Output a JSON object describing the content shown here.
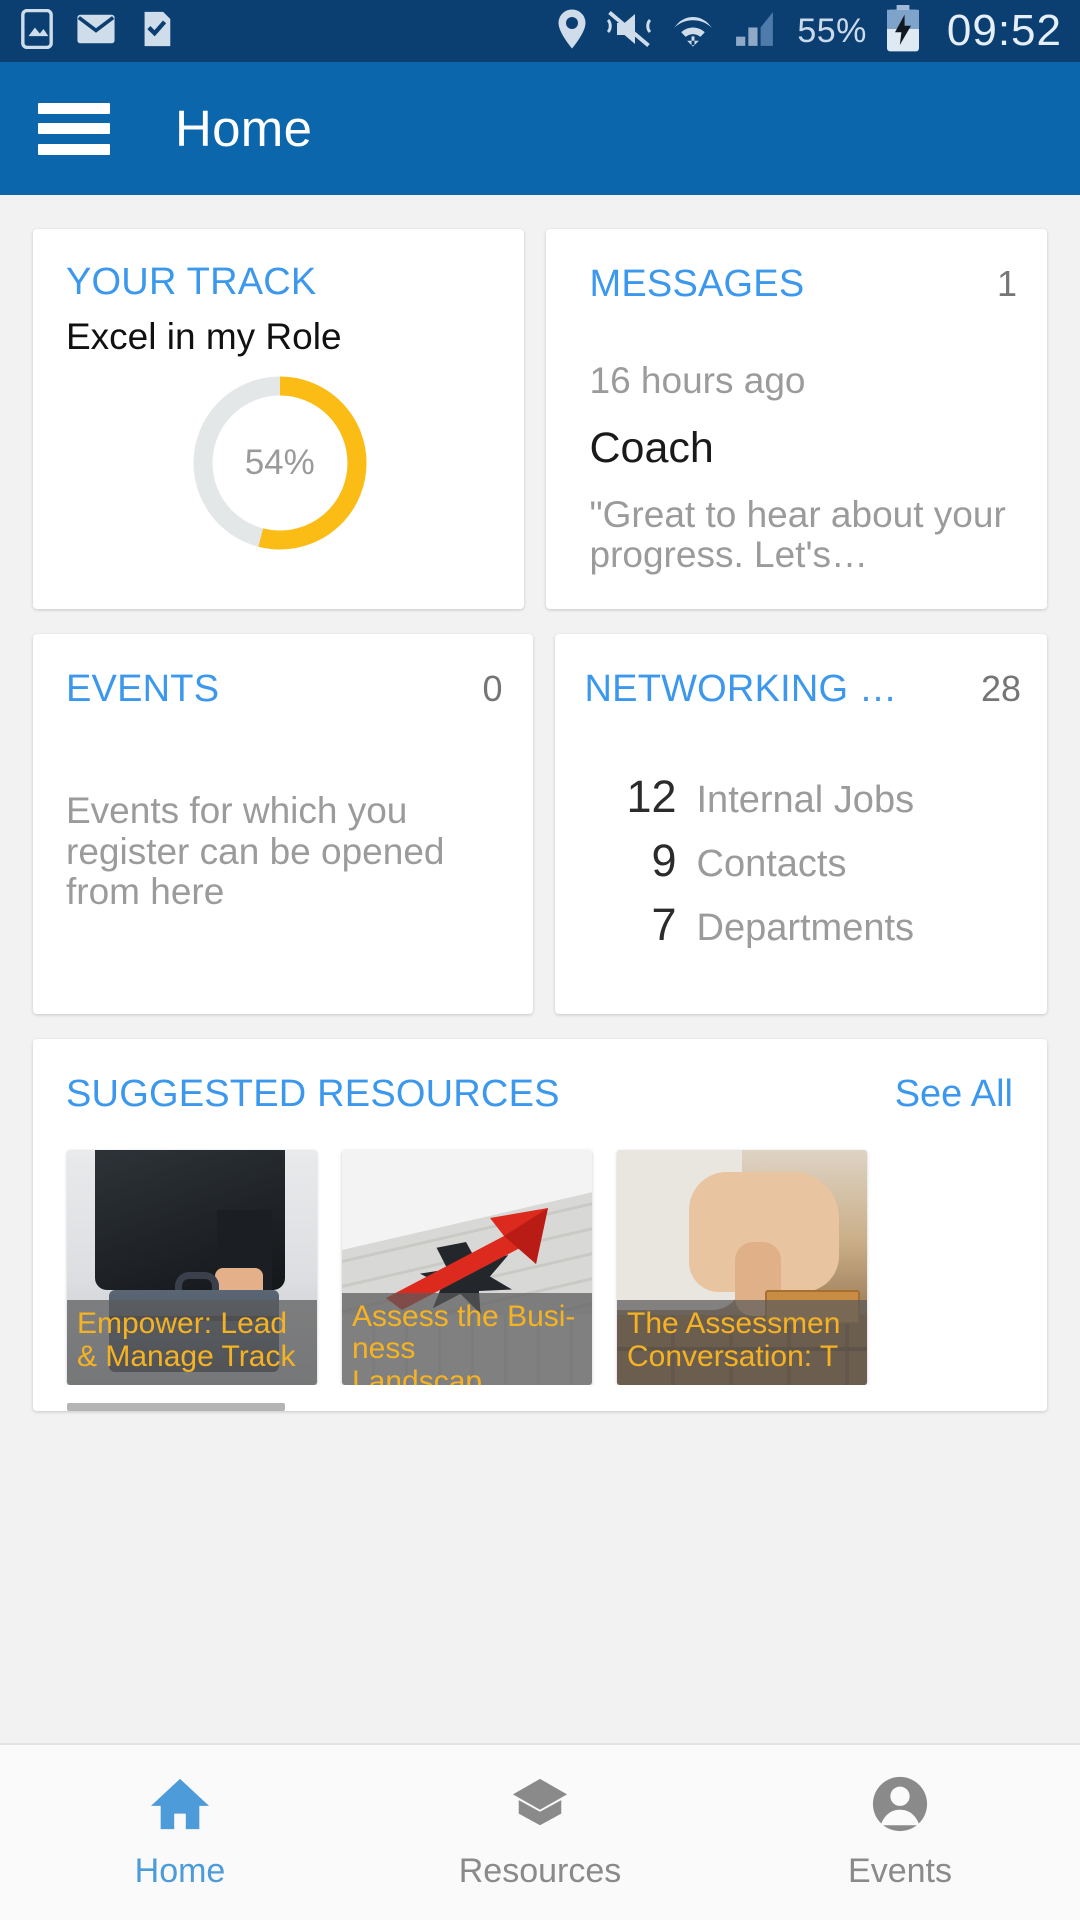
{
  "status_bar": {
    "icons_left": [
      "image-icon",
      "email-icon",
      "task-check-icon"
    ],
    "icons_right": [
      "location-pin-icon",
      "mute-vibrate-icon",
      "wifi-icon",
      "cellular-signal-icon"
    ],
    "battery_percent": "55%",
    "battery_icon": "battery-charging-icon",
    "clock": "09:52",
    "bg_color": "#0b3f72"
  },
  "app_bar": {
    "menu_icon": "hamburger-menu-icon",
    "title": "Home",
    "bg_color": "#0b66ab"
  },
  "cards": {
    "your_track": {
      "title": "YOUR TRACK",
      "subtitle": "Excel in my Role",
      "progress_label": "54%",
      "progress_value": 54,
      "ring_color": "#fbbc16",
      "ring_track_color": "#e4e7e8"
    },
    "messages": {
      "title": "MESSAGES",
      "count": "1",
      "time": "16 hours ago",
      "sender": "Coach",
      "preview": "\"Great to hear about your progress. Let's…"
    },
    "events": {
      "title": "EVENTS",
      "count": "0",
      "body": "Events for which you register can be opened from here"
    },
    "networking": {
      "title": "NETWORKING …",
      "count": "28",
      "items": [
        {
          "value": "12",
          "label": "Internal Jobs"
        },
        {
          "value": "9",
          "label": "Contacts"
        },
        {
          "value": "7",
          "label": "Departments"
        }
      ]
    },
    "suggested_resources": {
      "title": "SUGGESTED RESOURCES",
      "see_all": "See All",
      "thumbnails": [
        {
          "caption": "Empower: Lead & Manage Track",
          "art": "briefcase-photo"
        },
        {
          "caption": "Assess the Busi-ness Landscap…",
          "art": "arrow-through-wall-photo"
        },
        {
          "caption": "The Assessmen Conversation: T",
          "art": "hand-bricks-photo"
        }
      ]
    }
  },
  "bottom_nav": {
    "items": [
      {
        "label": "Home",
        "icon": "home-icon",
        "active": true
      },
      {
        "label": "Resources",
        "icon": "graduation-cap-icon",
        "active": false
      },
      {
        "label": "Events",
        "icon": "person-circle-icon",
        "active": false
      }
    ],
    "active_color": "#4d9bd8",
    "inactive_color": "#8a8a8a"
  },
  "theme": {
    "accent_blue": "#3b98ec",
    "header_blue": "#0b66ab",
    "status_blue": "#0b3f72",
    "amber": "#fbbc16",
    "caption_amber": "#f5b324"
  }
}
